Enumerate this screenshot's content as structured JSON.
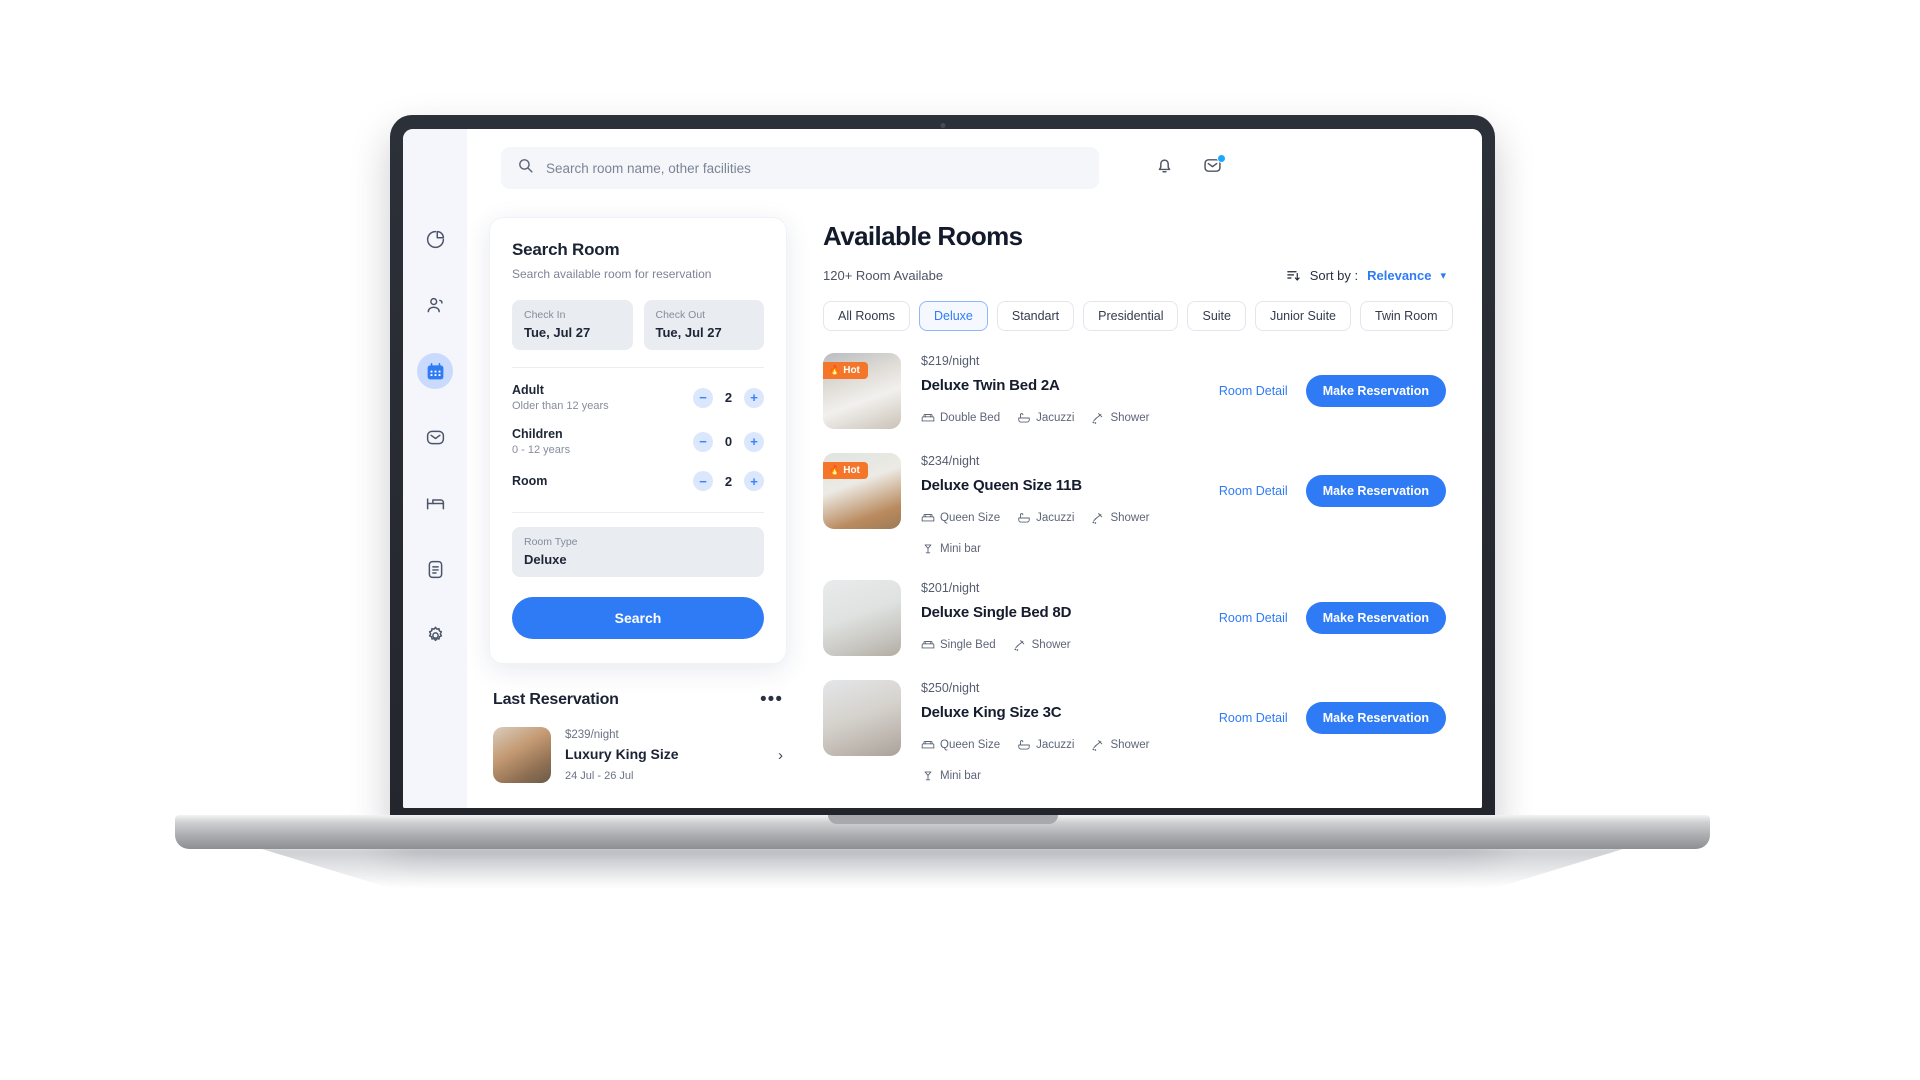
{
  "sidebar": {
    "items": [
      {
        "icon": "pie-chart-icon",
        "name": "analytics",
        "active": false
      },
      {
        "icon": "users-icon",
        "name": "guests",
        "active": false
      },
      {
        "icon": "calendar-icon",
        "name": "reservations",
        "active": true
      },
      {
        "icon": "mail-icon",
        "name": "messages",
        "active": false
      },
      {
        "icon": "bed-icon",
        "name": "rooms",
        "active": false
      },
      {
        "icon": "document-icon",
        "name": "reports",
        "active": false
      },
      {
        "icon": "gear-icon",
        "name": "settings",
        "active": false
      }
    ]
  },
  "topbar": {
    "search_placeholder": "Search room name, other facilities",
    "search_value": "",
    "notification_icon": "bell-icon",
    "mail_icon": "mail-icon",
    "mail_has_badge": true
  },
  "search_panel": {
    "title": "Search Room",
    "subtitle": "Search available room for reservation",
    "check_in": {
      "label": "Check In",
      "value": "Tue, Jul 27"
    },
    "check_out": {
      "label": "Check Out",
      "value": "Tue, Jul 27"
    },
    "counters": [
      {
        "title": "Adult",
        "hint": "Older than 12 years",
        "value": "2",
        "minus": "−",
        "plus": "+"
      },
      {
        "title": "Children",
        "hint": "0 - 12 years",
        "value": "0",
        "minus": "−",
        "plus": "+"
      },
      {
        "title": "Room",
        "hint": "",
        "value": "2",
        "minus": "−",
        "plus": "+"
      }
    ],
    "room_type": {
      "label": "Room Type",
      "value": "Deluxe"
    },
    "search_button": "Search"
  },
  "last_reservation": {
    "title": "Last Reservation",
    "menu_icon": "ellipsis-icon",
    "item": {
      "price": "$239/night",
      "name": "Luxury King Size",
      "dates": "24 Jul - 26 Jul",
      "chevron": "›"
    }
  },
  "available_rooms": {
    "title": "Available Rooms",
    "count_text": "120+ Room Availabe",
    "sort": {
      "icon": "sort-icon",
      "label": "Sort by :",
      "value": "Relevance",
      "caret": "⌄"
    },
    "filters": [
      {
        "label": "All Rooms",
        "active": false
      },
      {
        "label": "Deluxe",
        "active": true
      },
      {
        "label": "Standart",
        "active": false
      },
      {
        "label": "Presidential",
        "active": false
      },
      {
        "label": "Suite",
        "active": false
      },
      {
        "label": "Junior Suite",
        "active": false
      },
      {
        "label": "Twin Room",
        "active": false
      }
    ],
    "detail_link": "Room Detail",
    "reserve_button": "Make Reservation",
    "hot_badge": "Hot",
    "rooms": [
      {
        "price": "$219/night",
        "name": "Deluxe Twin Bed 2A",
        "hot": true,
        "amenities": [
          "Double Bed",
          "Jacuzzi",
          "Shower"
        ]
      },
      {
        "price": "$234/night",
        "name": "Deluxe Queen Size 11B",
        "hot": true,
        "amenities": [
          "Queen Size",
          "Jacuzzi",
          "Shower",
          "Mini bar"
        ]
      },
      {
        "price": "$201/night",
        "name": "Deluxe Single Bed 8D",
        "hot": false,
        "amenities": [
          "Single Bed",
          "Shower"
        ]
      },
      {
        "price": "$250/night",
        "name": "Deluxe King Size 3C",
        "hot": false,
        "amenities": [
          "Queen Size",
          "Jacuzzi",
          "Shower",
          "Mini bar"
        ]
      }
    ]
  },
  "colors": {
    "accent": "#2f7bf6",
    "hot": "#f4762a",
    "sidebar_bg": "#f4f6fb",
    "field_bg": "#e9ecf1",
    "badge": "#18a9ff"
  }
}
